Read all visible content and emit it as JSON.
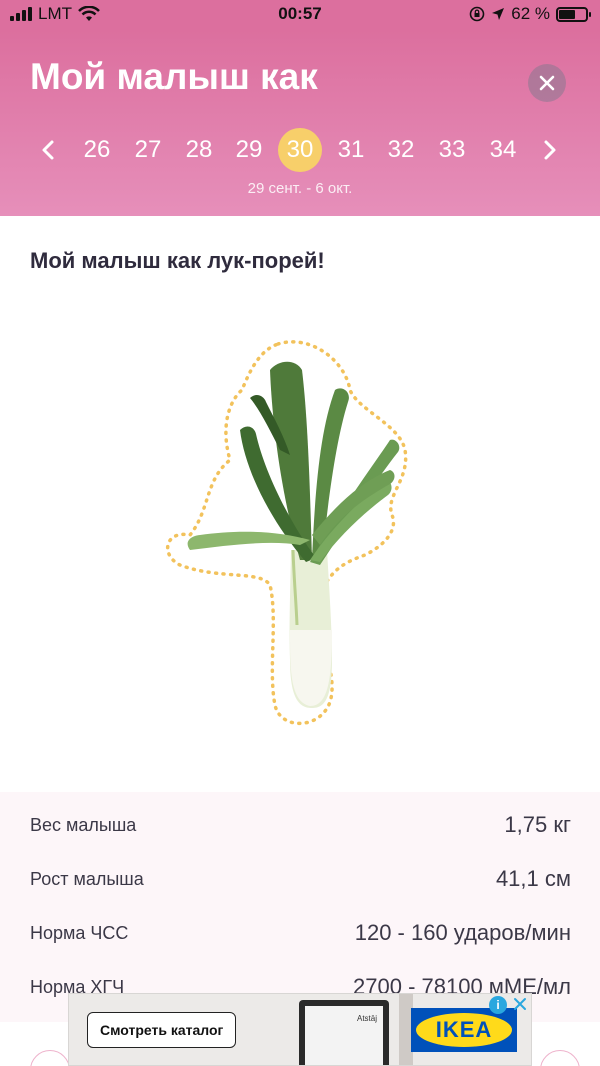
{
  "status_bar": {
    "carrier": "LMT",
    "time": "00:57",
    "battery": "62 %",
    "battery_level": 0.62
  },
  "header": {
    "title": "Мой малыш как",
    "weeks": [
      "26",
      "27",
      "28",
      "29",
      "30",
      "31",
      "32",
      "33",
      "34"
    ],
    "active_week": "30",
    "date_range": "29 сент. - 6 окт."
  },
  "main": {
    "heading": "Мой малыш как лук-порей!",
    "illustration": "leek"
  },
  "stats": [
    {
      "label": "Вес малыша",
      "value": "1,75 кг"
    },
    {
      "label": "Рост малыша",
      "value": "41,1 см"
    },
    {
      "label": "Норма ЧСС",
      "value": "120 - 160 ударов/мин"
    },
    {
      "label": "Норма ХГЧ",
      "value": "2700 - 78100 мМЕ/мл"
    }
  ],
  "ad": {
    "button_label": "Смотреть каталог",
    "screen_text": "Atstāj",
    "brand": "IKEA",
    "info_glyph": "i"
  },
  "colors": {
    "header_top": "#dc6f9e",
    "header_bottom": "#e68fba",
    "active_week": "#f7cf6a",
    "stats_bg": "#fdf6f9"
  }
}
